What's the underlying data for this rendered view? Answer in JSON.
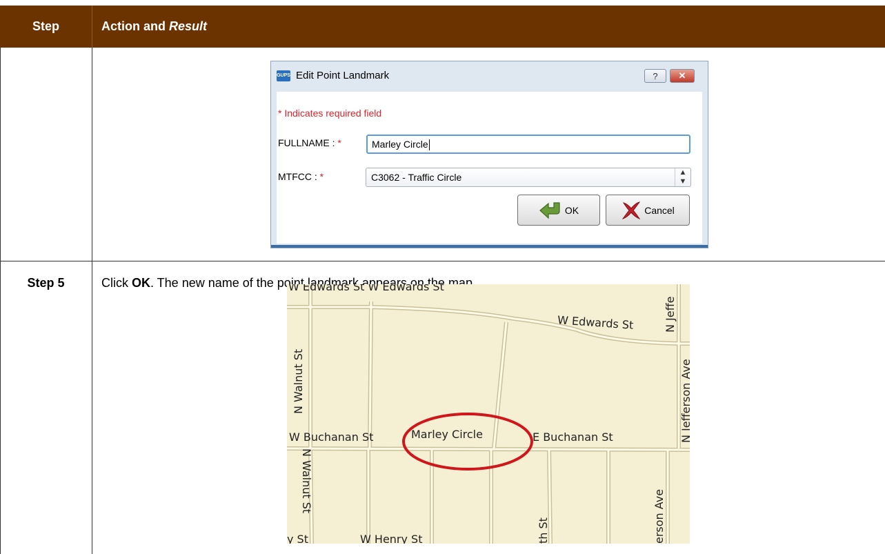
{
  "table": {
    "header": {
      "step": "Step",
      "action": "Action and",
      "result": "Result"
    },
    "row2": {
      "step": "Step 5",
      "text_pre": "Click ",
      "text_bold": "OK",
      "text_post": ". The new name of the point landmark appears on the map."
    }
  },
  "dialog": {
    "app_icon_text": "GUPS",
    "title": "Edit Point Landmark",
    "help_label": "?",
    "close_label": "✕",
    "required_note": "* Indicates required field",
    "fullname_label": "FULLNAME :",
    "fullname_value": "Marley Circle",
    "mtfcc_label": "MTFCC :",
    "mtfcc_value": "C3062 - Traffic Circle",
    "star": "*",
    "ok_label": "OK",
    "cancel_label": "Cancel"
  },
  "map": {
    "labels": {
      "w_edwards_top": "W Edwards St W Edwards St",
      "w_edwards_right": "W Edwards St",
      "n_jeff_top": "N Jeffe",
      "n_walnut_upper": "N Walnut St",
      "n_jefferson_ave": "N Jefferson Ave",
      "w_buchanan": "W Buchanan St",
      "marley": "Marley Circle",
      "e_buchanan": "E Buchanan St",
      "n_jeff_right": "N Jeffe",
      "n_walnut_lower": "N Walnut St",
      "th_st": "th St",
      "erson_ave": "erson Ave",
      "y_st": "y St",
      "w_henry": "W Henry St"
    }
  }
}
